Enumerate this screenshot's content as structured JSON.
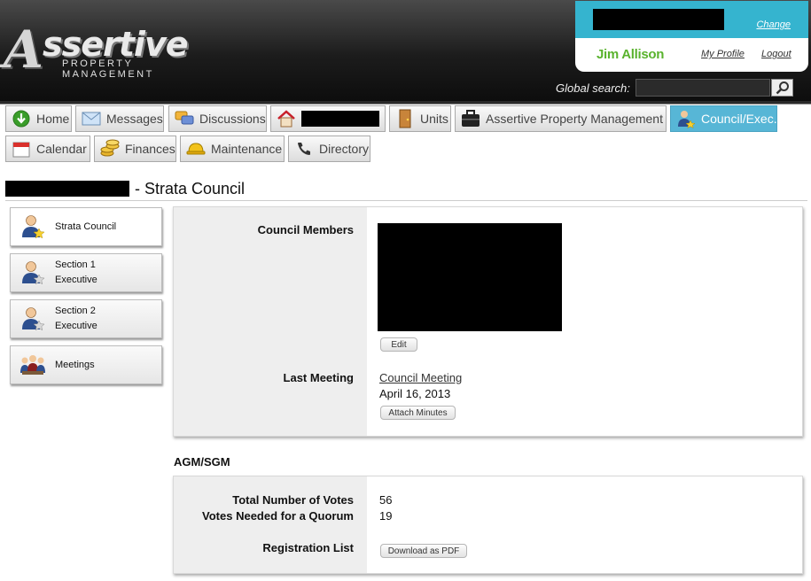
{
  "header": {
    "logo_word": "ssertive",
    "logo_letter": "A",
    "logo_sub": "PROPERTY MANAGEMENT",
    "change_link": "Change",
    "user_name": "Jim Allison",
    "profile_link": "My Profile",
    "logout_link": "Logout",
    "search_label": "Global search:",
    "search_value": ""
  },
  "nav": {
    "home": "Home",
    "messages": "Messages",
    "discussions": "Discussions",
    "units": "Units",
    "company": "Assertive Property Management",
    "council": "Council/Exec.",
    "calendar": "Calendar",
    "finances": "Finances",
    "maintenance": "Maintenance",
    "directory": "Directory"
  },
  "page": {
    "title_suffix": "- Strata Council"
  },
  "sidebar": {
    "items": [
      {
        "line1": "Strata Council",
        "line2": ""
      },
      {
        "line1": "Section 1",
        "line2": "Executive"
      },
      {
        "line1": "Section 2",
        "line2": "Executive"
      },
      {
        "line1": "Meetings",
        "line2": ""
      }
    ]
  },
  "council": {
    "members_label": "Council Members",
    "edit_button": "Edit",
    "last_meeting_label": "Last Meeting",
    "meeting_link": "Council Meeting",
    "meeting_date": "April 16, 2013",
    "attach_button": "Attach Minutes"
  },
  "agm": {
    "heading": "AGM/SGM",
    "total_votes_label": "Total Number of Votes",
    "total_votes": "56",
    "quorum_label": "Votes Needed for a Quorum",
    "quorum": "19",
    "registration_label": "Registration List",
    "download_button": "Download as PDF"
  },
  "colors": {
    "accent": "#35b4cf",
    "active_tab": "#57b6d6",
    "user_name": "#5ab32e"
  }
}
